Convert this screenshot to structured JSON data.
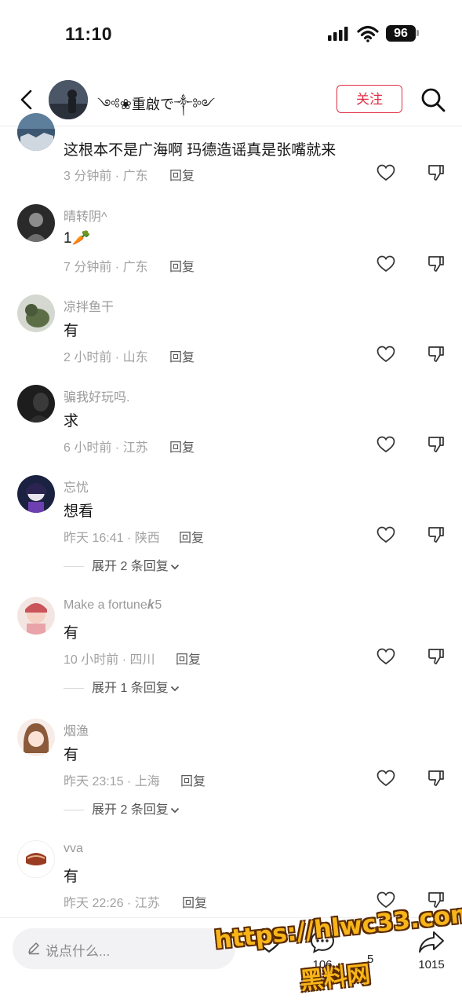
{
  "status_bar": {
    "time": "11:10",
    "battery": "96"
  },
  "header": {
    "author_name": "༺❀重啟で༒༻",
    "follow_label": "关注"
  },
  "comments": [
    {
      "user": "",
      "text": "这根本不是广海啊 玛德造谣真是张嘴就来",
      "time_location": "3 分钟前 · 广东",
      "reply_label": "回复"
    },
    {
      "user": "晴转阴^",
      "text": "1🥕",
      "time_location": "7 分钟前 · 广东",
      "reply_label": "回复"
    },
    {
      "user": "凉拌鱼干",
      "text": "有",
      "time_location": "2 小时前 · 山东",
      "reply_label": "回复"
    },
    {
      "user": "骗我好玩吗.",
      "text": "求",
      "time_location": "6 小时前 · 江苏",
      "reply_label": "回复"
    },
    {
      "user": "忘忧",
      "text": "想看",
      "time_location": "昨天 16:41 · 陕西",
      "reply_label": "回复",
      "expand": "展开 2 条回复"
    },
    {
      "user": "Make a fortune𝒌5",
      "text": "有",
      "time_location": "10 小时前 · 四川",
      "reply_label": "回复",
      "expand": "展开 1 条回复"
    },
    {
      "user": "烟渔",
      "text": "有",
      "time_location": "昨天 23:15 · 上海",
      "reply_label": "回复",
      "expand": "展开 2 条回复"
    },
    {
      "user": "vva",
      "text": "有",
      "time_location": "昨天 22:26 · 江苏",
      "reply_label": "回复"
    }
  ],
  "bottom_bar": {
    "input_placeholder": "说点什么...",
    "like_count": "",
    "comment_count": "106",
    "star_count": "5",
    "share_count": "1015"
  },
  "watermark": {
    "url": "https://hlwc33.com",
    "name": "黑料网"
  },
  "colors": {
    "accent": "#e02f44",
    "watermark": "#f7b519"
  },
  "icons": [
    "back-icon",
    "search-icon",
    "heart-icon",
    "dislike-icon",
    "pen-icon",
    "comment-icon",
    "share-icon",
    "chevron-down-icon"
  ]
}
